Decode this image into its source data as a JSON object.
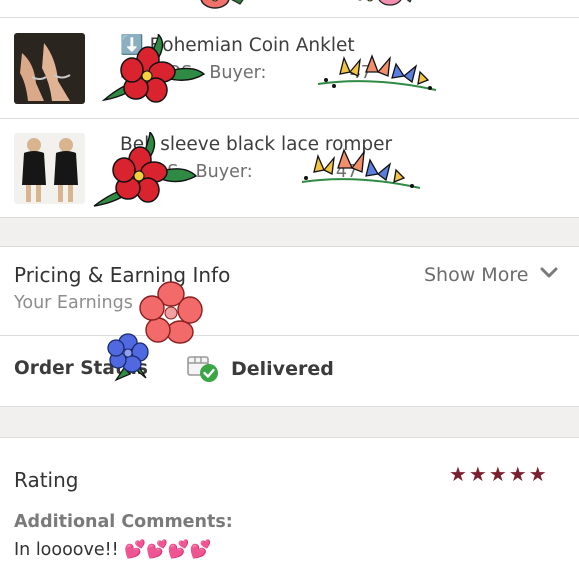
{
  "items": [
    {
      "prefix_icon": "down-arrow-emoji-icon",
      "prefix_glyph": "⬇️",
      "title": "Bohemian Coin Anklet",
      "meta_size": "Size: OS",
      "meta_buyer": "Buyer:",
      "meta_tail": "47"
    },
    {
      "title": "Bell sleeve black lace romper",
      "meta_size": "Size: S",
      "meta_buyer": "Buyer:",
      "meta_tail": "47"
    }
  ],
  "pricing": {
    "title": "Pricing & Earning Info",
    "subtitle": "Your Earnings",
    "show_more": "Show More"
  },
  "order_status": {
    "label": "Order Status",
    "value": "Delivered"
  },
  "rating": {
    "label": "Rating",
    "stars": 5,
    "star_glyphs": "★★★★★",
    "star_color": "#7a1f2e",
    "comments_label": "Additional Comments:",
    "comment_text": "In loooove!!",
    "comment_emoji": "💕💕💕💕"
  },
  "colors": {
    "delivered_check": "#3aa544",
    "divider": "#dcdcdc",
    "section_gap": "#f1f0ee"
  }
}
